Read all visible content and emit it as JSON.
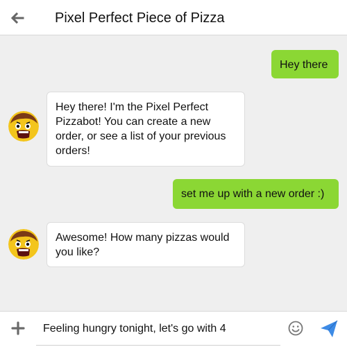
{
  "header": {
    "title": "Pixel Perfect Piece of Pizza",
    "back_icon": "arrow-left-icon"
  },
  "messages": [
    {
      "sender": "user",
      "text": "Hey there"
    },
    {
      "sender": "bot",
      "text": "Hey there! I'm the Pixel Perfect Pizzabot! You can create a new order, or see a list of your previous orders!"
    },
    {
      "sender": "user",
      "text": "set me up with a new order :)"
    },
    {
      "sender": "bot",
      "text": "Awesome! How many pizzas would you like?"
    }
  ],
  "composer": {
    "value": "Feeling hungry tonight, let's go with 4",
    "add_icon": "plus-icon",
    "emoji_icon": "smiley-icon",
    "send_icon": "paper-plane-icon"
  },
  "colors": {
    "user_bubble": "#8bd734",
    "bot_bubble": "#ffffff",
    "send_accent": "#3d8be6",
    "background": "#efefef"
  }
}
